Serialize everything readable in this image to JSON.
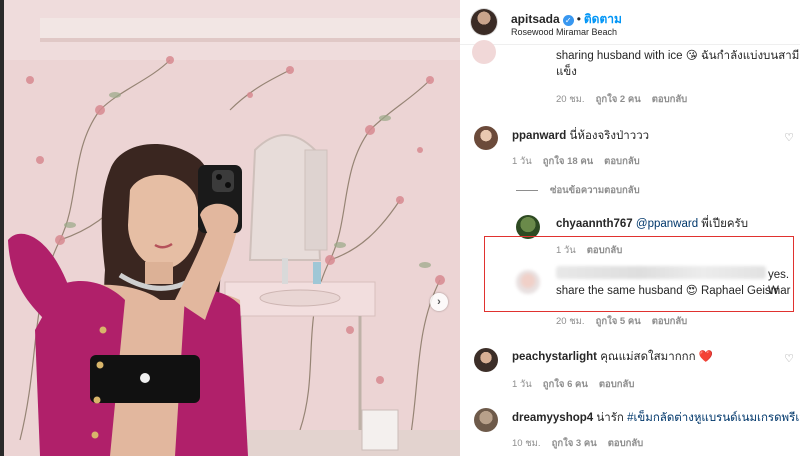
{
  "header": {
    "username": "apitsada",
    "follow_label": "ติดตาม",
    "location": "Rosewood Miramar Beach",
    "separator": "•"
  },
  "comments": [
    {
      "username": "",
      "text": "sharing husband with ice 😘 ฉันกำลังแบ่งบนสามีกับน้ำ",
      "text_cont": "แข็ง",
      "time": "20 ชม.",
      "likes": "ถูกใจ 2 คน",
      "reply_label": "ตอบกลับ"
    },
    {
      "username": "ppanward",
      "text": "นี่ห้องจริงป่าววว",
      "time": "1 วัน",
      "likes": "ถูกใจ 18 คน",
      "reply_label": "ตอบกลับ"
    },
    {
      "username": "chyaannth767",
      "mention": "@ppanward",
      "text": "พี่เปียครับ",
      "time": "1 วัน",
      "reply_label": "ตอบกลับ"
    },
    {
      "username": "",
      "text_tail": "yes. W",
      "text": "share the same husband 😍 Raphael Geismar",
      "time": "20 ชม.",
      "likes": "ถูกใจ 5 คน",
      "reply_label": "ตอบกลับ"
    },
    {
      "username": "peachystarlight",
      "text": "คุณแม่สดใสมากกก ❤️",
      "time": "1 วัน",
      "likes": "ถูกใจ 6 คน",
      "reply_label": "ตอบกลับ"
    },
    {
      "username": "dreamyyshop4",
      "text": "น่ารัก",
      "hashtag": "#เข็มกลัดต่างหูแบรนด์เนมเกรดพรีเมีย",
      "time": "10 ชม.",
      "likes": "ถูกใจ 3 คน",
      "reply_label": "ตอบกลับ"
    }
  ],
  "hide_replies_label": "ซ่อนข้อความตอบกลับ",
  "next_arrow": "›",
  "icons": {
    "verified": "verified-badge-icon",
    "heart": "heart-icon",
    "next": "chevron-right-icon"
  },
  "colors": {
    "accent": "#0095f6",
    "link": "#00376b",
    "meta": "#8e8e8e",
    "highlight_box": "#e0322f",
    "wallpaper": "#ead2d3"
  }
}
